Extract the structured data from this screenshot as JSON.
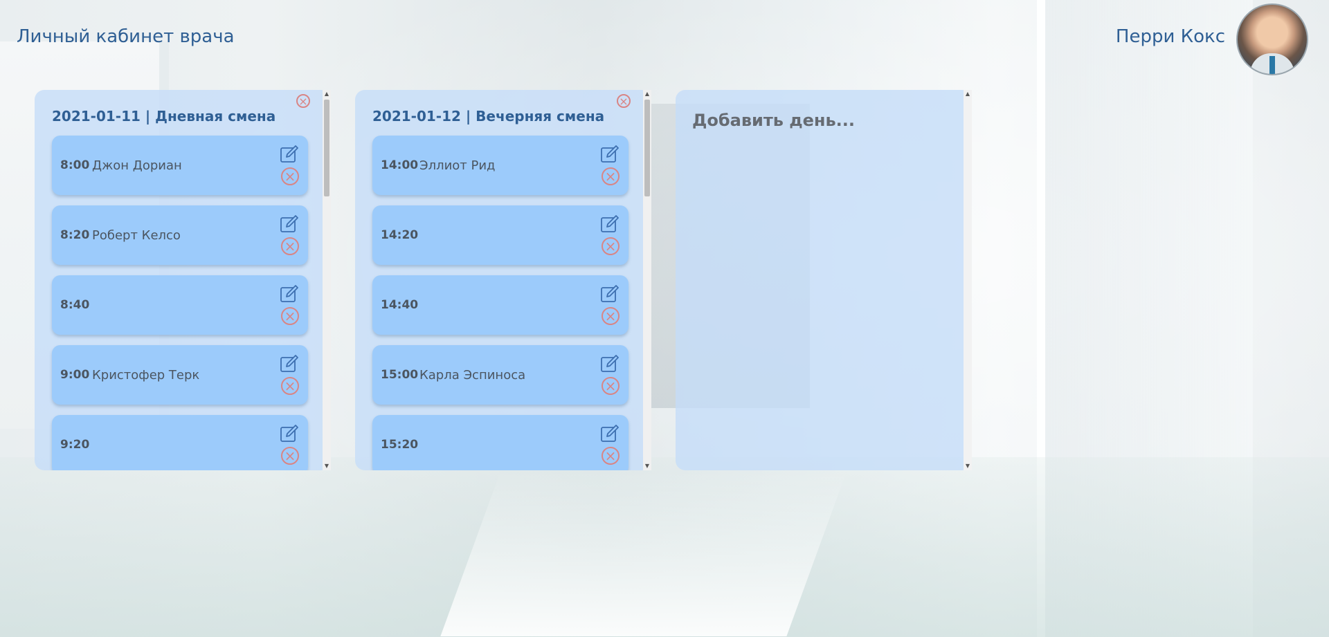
{
  "header": {
    "title": "Личный кабинет врача",
    "user_name": "Перри Кокс"
  },
  "days": [
    {
      "title": "2021-01-11 | Дневная смена",
      "slots": [
        {
          "time": "8:00",
          "patient": "Джон Дориан"
        },
        {
          "time": "8:20",
          "patient": "Роберт Келсо"
        },
        {
          "time": "8:40",
          "patient": ""
        },
        {
          "time": "9:00",
          "patient": "Кристофер Терк"
        },
        {
          "time": "9:20",
          "patient": ""
        }
      ]
    },
    {
      "title": "2021-01-12 | Вечерняя смена",
      "slots": [
        {
          "time": "14:00",
          "patient": "Эллиот Рид"
        },
        {
          "time": "14:20",
          "patient": ""
        },
        {
          "time": "14:40",
          "patient": ""
        },
        {
          "time": "15:00",
          "patient": "Карла Эспиноса"
        },
        {
          "time": "15:20",
          "patient": ""
        }
      ]
    }
  ],
  "add_day": {
    "label": "Добавить день..."
  },
  "icons": {
    "close": "close-icon",
    "edit": "edit-icon",
    "scroll_up": "scroll-up-icon",
    "scroll_down": "scroll-down-icon"
  },
  "colors": {
    "accent": "#2f5f94",
    "card": "#9ccbfb",
    "column": "#c8def8",
    "delete": "#d98585"
  }
}
